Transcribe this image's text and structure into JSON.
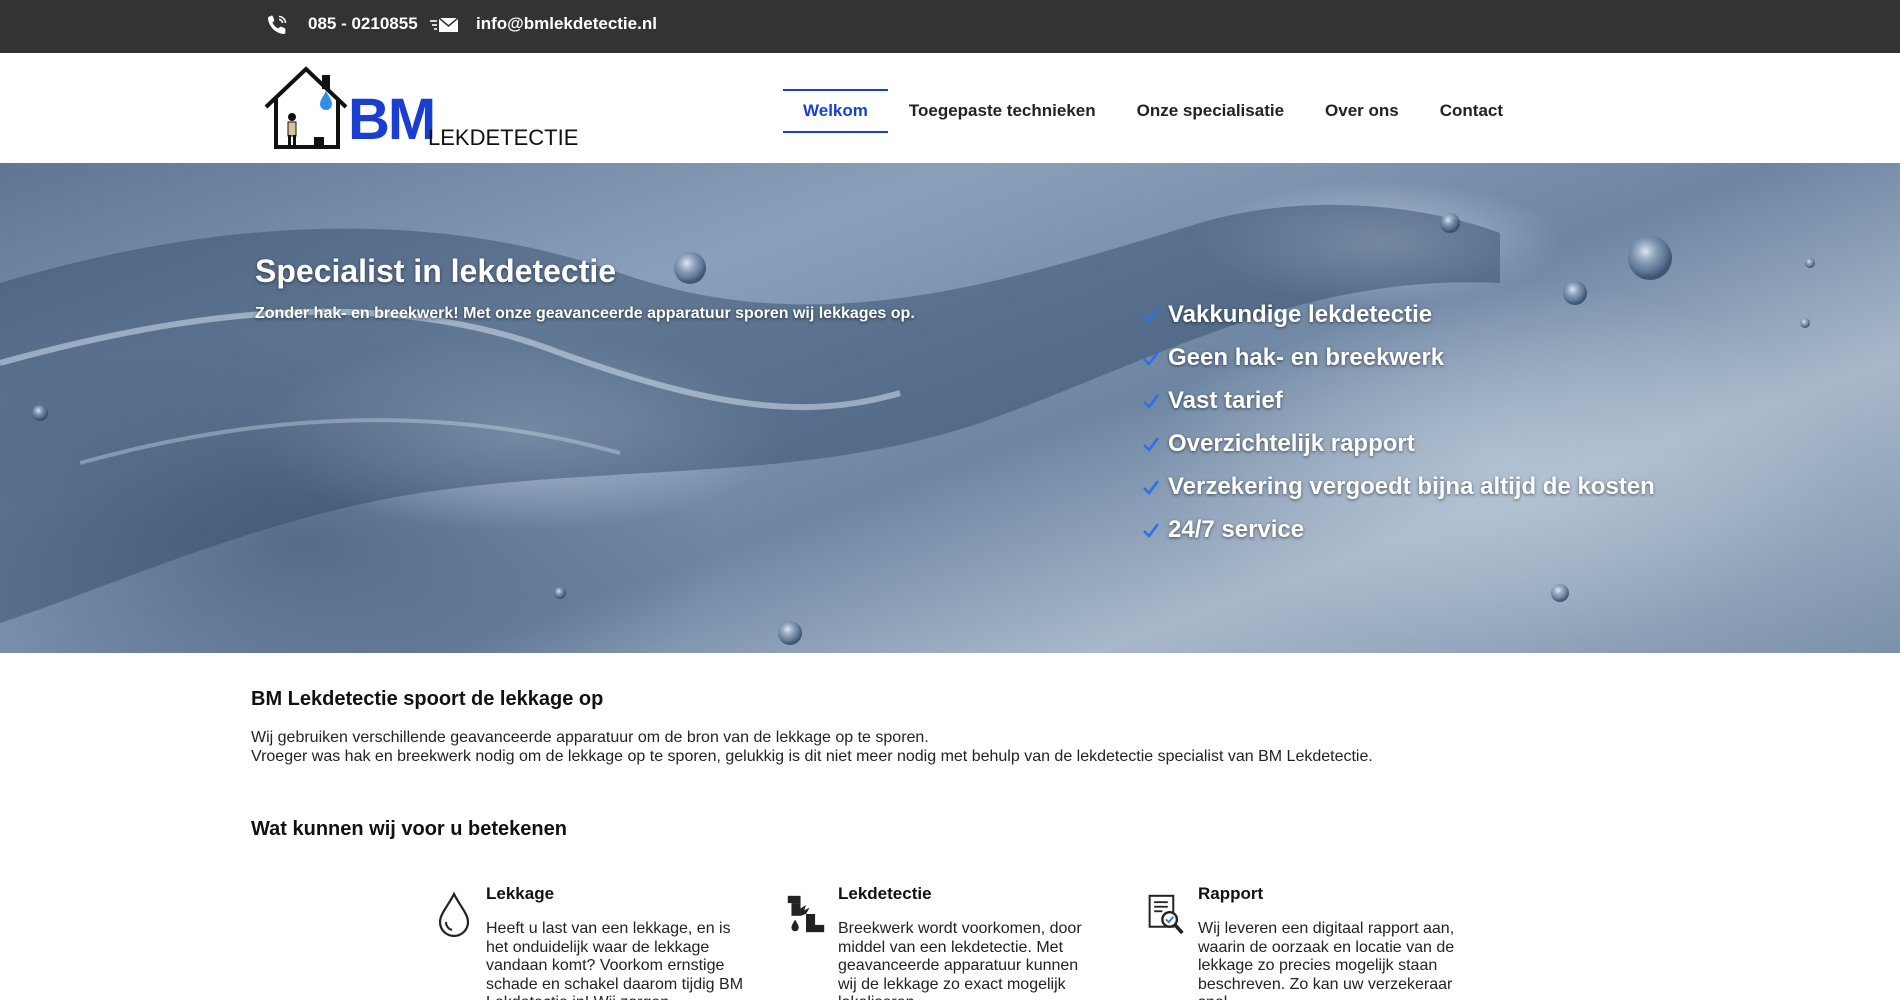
{
  "topbar": {
    "phone": "085 - 0210855",
    "email": "info@bmlekdetectie.nl",
    "phone_icon": "phone-icon",
    "mail_icon": "mail-icon"
  },
  "logo": {
    "bm": "BM",
    "sub": "LEKDETECTIE"
  },
  "nav": {
    "items": [
      {
        "label": "Welkom",
        "active": true
      },
      {
        "label": "Toegepaste technieken",
        "active": false
      },
      {
        "label": "Onze specialisatie",
        "active": false
      },
      {
        "label": "Over ons",
        "active": false
      },
      {
        "label": "Contact",
        "active": false
      }
    ]
  },
  "hero": {
    "title": "Specialist in lekdetectie",
    "subtitle": "Zonder hak- en breekwerk! Met onze geavanceerde apparatuur sporen wij lekkages op.",
    "features": [
      "Vakkundige lekdetectie",
      "Geen hak- en breekwerk",
      "Vast tarief",
      "Overzichtelijk rapport",
      "Verzekering vergoedt bijna altijd de kosten",
      "24/7 service"
    ]
  },
  "intro": {
    "title": "BM Lekdetectie spoort de lekkage op",
    "line1": "Wij gebruiken verschillende geavanceerde apparatuur om de bron van de lekkage op te sporen.",
    "line2": "Vroeger was hak en breekwerk nodig om de lekkage op te sporen, gelukkig is dit niet meer nodig met behulp van de lekdetectie specialist van BM Lekdetectie."
  },
  "services": {
    "title": "Wat kunnen wij voor u betekenen",
    "items": [
      {
        "title": "Lekkage",
        "icon": "water-drop-icon",
        "text": "Heeft u last van een lekkage, en is het onduidelijk waar de lekkage vandaan komt? Voorkom ernstige schade en schakel daarom tijdig BM Lekdetectie in! Wij zorgen"
      },
      {
        "title": "Lekdetectie",
        "icon": "broken-pipe-icon",
        "text": "Breekwerk wordt voorkomen, door middel van een lekdetectie. Met geavanceerde apparatuur kunnen wij de lekkage zo exact mogelijk lokaliseren"
      },
      {
        "title": "Rapport",
        "icon": "report-search-icon",
        "text": "Wij leveren een digitaal rapport aan, waarin de oorzaak en locatie van de lekkage zo precies mogelijk staan beschreven. Zo kan uw verzekeraar snel"
      }
    ]
  },
  "colors": {
    "topbar_bg": "#333333",
    "brand_blue": "#1a3fd0",
    "check_blue": "#2f6fe8"
  }
}
